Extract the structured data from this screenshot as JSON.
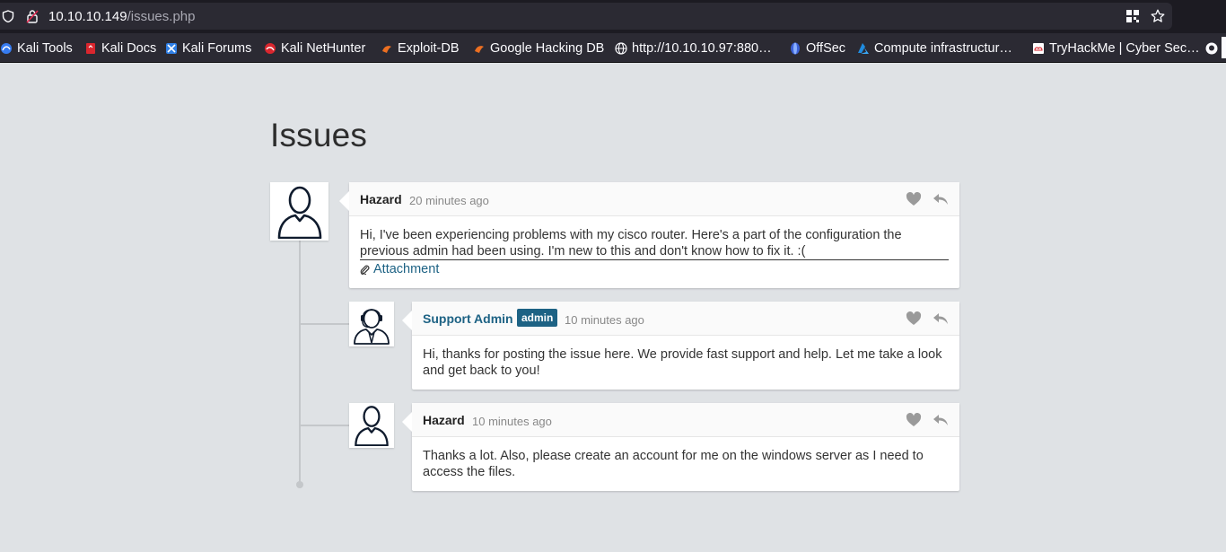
{
  "browser": {
    "url_host": "10.10.10.149",
    "url_path": "/issues.php"
  },
  "bookmarks": [
    {
      "label": "Kali Tools",
      "icon": "kali-dragon-icon"
    },
    {
      "label": "Kali Docs",
      "icon": "kali-docs-icon"
    },
    {
      "label": "Kali Forums",
      "icon": "kali-forums-icon"
    },
    {
      "label": "Kali NetHunter",
      "icon": "kali-nethunter-icon"
    },
    {
      "label": "Exploit-DB",
      "icon": "exploit-db-icon"
    },
    {
      "label": "Google Hacking DB",
      "icon": "ghdb-icon"
    },
    {
      "label": "http://10.10.10.97:880…",
      "icon": "globe-icon"
    },
    {
      "label": "OffSec",
      "icon": "offsec-icon"
    },
    {
      "label": "Compute infrastructur…",
      "icon": "azure-icon"
    },
    {
      "label": "TryHackMe | Cyber Sec…",
      "icon": "tryhackme-icon"
    }
  ],
  "page": {
    "title": "Issues"
  },
  "comments": [
    {
      "author": "Hazard",
      "time": "20 minutes ago",
      "body": "Hi, I've been experiencing problems with my cisco router. Here's a part of the configuration the previous admin had been using. I'm new to this and don't know how to fix it. :(",
      "attachment": "Attachment"
    },
    {
      "author": "Support Admin",
      "badge": "admin",
      "time": "10 minutes ago",
      "body": "Hi, thanks for posting the issue here. We provide fast support and help. Let me take a look and get back to you!"
    },
    {
      "author": "Hazard",
      "time": "10 minutes ago",
      "body": "Thanks a lot. Also, please create an account for me on the windows server as I need to access the files."
    }
  ],
  "colors": {
    "accent": "#1d6284",
    "page_bg": "#dfe2e5",
    "chrome_bg": "#2b2a33"
  }
}
